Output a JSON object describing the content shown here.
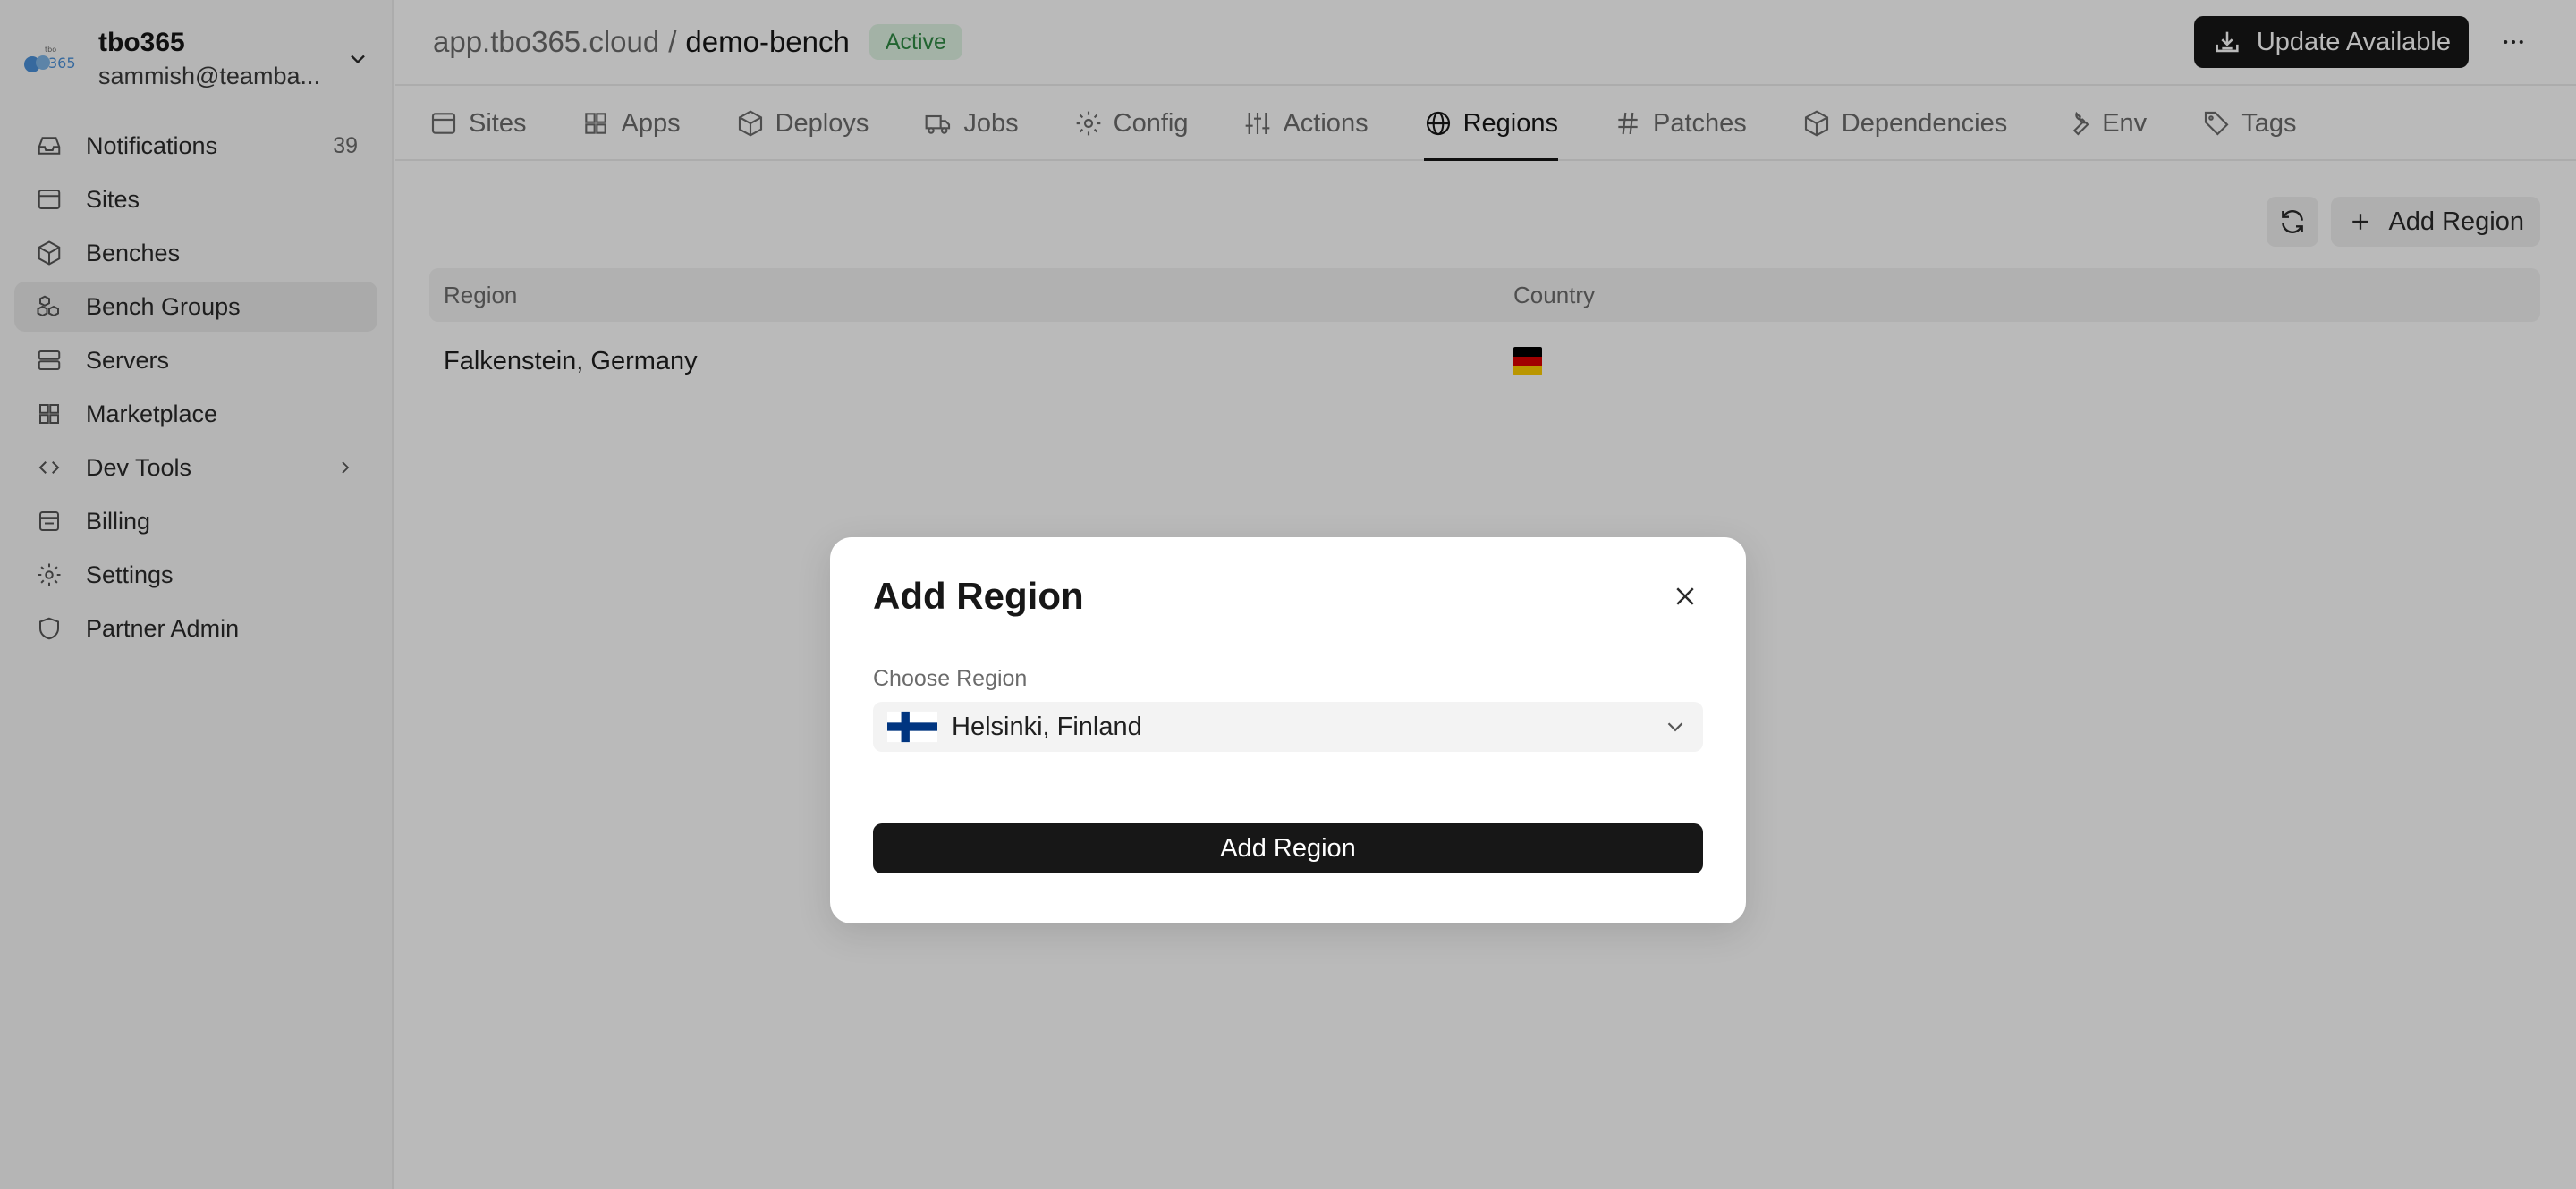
{
  "org": {
    "name": "tbo365",
    "email": "sammish@teamba..."
  },
  "sidebar": {
    "items": [
      {
        "label": "Notifications",
        "count": "39",
        "icon": "inbox-icon"
      },
      {
        "label": "Sites",
        "icon": "browser-icon"
      },
      {
        "label": "Benches",
        "icon": "package-icon"
      },
      {
        "label": "Bench Groups",
        "icon": "boxes-icon",
        "active": true
      },
      {
        "label": "Servers",
        "icon": "server-icon"
      },
      {
        "label": "Marketplace",
        "icon": "grid-icon"
      },
      {
        "label": "Dev Tools",
        "icon": "code-icon",
        "expandable": true
      },
      {
        "label": "Billing",
        "icon": "wallet-icon"
      },
      {
        "label": "Settings",
        "icon": "gear-icon"
      },
      {
        "label": "Partner Admin",
        "icon": "shield-icon"
      }
    ]
  },
  "header": {
    "breadcrumb_root": "app.tbo365.cloud",
    "breadcrumb_sep": "/",
    "breadcrumb_current": "demo-bench",
    "status_badge": "Active",
    "update_label": "Update Available"
  },
  "tabs": [
    {
      "label": "Sites",
      "icon": "browser-icon"
    },
    {
      "label": "Apps",
      "icon": "grid-icon"
    },
    {
      "label": "Deploys",
      "icon": "package-icon"
    },
    {
      "label": "Jobs",
      "icon": "truck-icon"
    },
    {
      "label": "Config",
      "icon": "gear-icon"
    },
    {
      "label": "Actions",
      "icon": "sliders-icon"
    },
    {
      "label": "Regions",
      "icon": "globe-icon",
      "active": true
    },
    {
      "label": "Patches",
      "icon": "hash-icon"
    },
    {
      "label": "Dependencies",
      "icon": "package-icon"
    },
    {
      "label": "Env",
      "icon": "wrench-icon"
    },
    {
      "label": "Tags",
      "icon": "tag-icon"
    }
  ],
  "toolbar": {
    "add_region_label": "Add Region"
  },
  "table": {
    "columns": [
      "Region",
      "Country"
    ],
    "rows": [
      {
        "region": "Falkenstein, Germany",
        "country_flag": "germany-flag"
      }
    ]
  },
  "modal": {
    "title": "Add Region",
    "field_label": "Choose Region",
    "selected_region": "Helsinki, Finland",
    "selected_flag": "finland-flag",
    "submit_label": "Add Region"
  },
  "colors": {
    "primary": "#171717",
    "badge_bg": "#e0f4e4",
    "badge_text": "#2f8a44",
    "overlay": "rgba(0,0,0,0.27)"
  }
}
